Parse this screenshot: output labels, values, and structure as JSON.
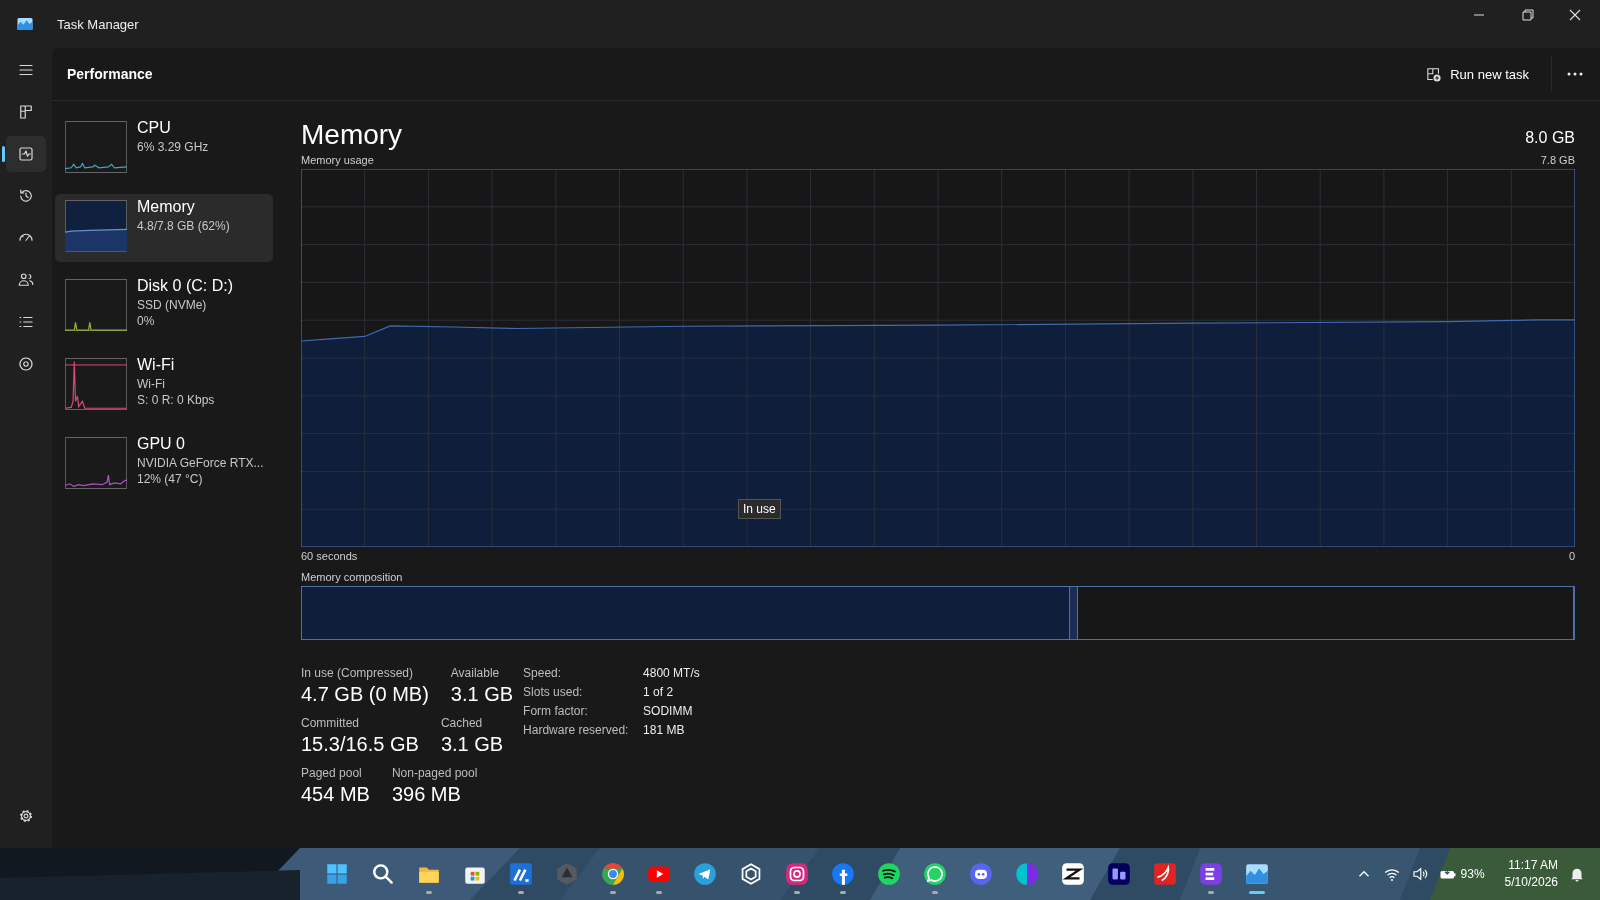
{
  "window": {
    "title": "Task Manager"
  },
  "nav": {
    "items": [
      {
        "kind": "menu",
        "selected": false
      },
      {
        "kind": "processes",
        "selected": false
      },
      {
        "kind": "performance",
        "selected": true
      },
      {
        "kind": "app_history",
        "selected": false
      },
      {
        "kind": "startup",
        "selected": false
      },
      {
        "kind": "users",
        "selected": false
      },
      {
        "kind": "details",
        "selected": false
      },
      {
        "kind": "services",
        "selected": false
      }
    ],
    "footer": {
      "kind": "settings",
      "selected": false
    }
  },
  "header": {
    "title": "Performance",
    "run_new_task": "Run new task"
  },
  "devices": [
    {
      "kind": "cpu",
      "name": "CPU",
      "lines": [
        "6% 3.29 GHz"
      ],
      "color": "#3aa8c8",
      "selected": false
    },
    {
      "kind": "memory",
      "name": "Memory",
      "lines": [
        "4.8/7.8 GB (62%)"
      ],
      "color": "#6b8fd0",
      "selected": true
    },
    {
      "kind": "disk",
      "name": "Disk 0 (C: D:)",
      "lines": [
        "SSD (NVMe)",
        "0%"
      ],
      "color": "#8fb339",
      "selected": false
    },
    {
      "kind": "wifi",
      "name": "Wi-Fi",
      "lines": [
        "Wi-Fi",
        "S: 0 R: 0 Kbps"
      ],
      "color": "#d6487e",
      "selected": false
    },
    {
      "kind": "gpu",
      "name": "GPU 0",
      "lines": [
        "NVIDIA GeForce RTX...",
        "12% (47 °C)"
      ],
      "color": "#b04fc9",
      "selected": false
    }
  ],
  "memory": {
    "title": "Memory",
    "total": "8.0 GB",
    "usage_label": "Memory usage",
    "usage_max": "7.8 GB",
    "x_start": "60 seconds",
    "x_end": "0",
    "tooltip": "In use",
    "composition_label": "Memory composition",
    "composition": [
      {
        "kind": "in_use",
        "level": 0.603
      },
      {
        "kind": "modified",
        "level": 0.006
      },
      {
        "kind": "standby",
        "level": 0.389
      }
    ],
    "stat_rows": [
      [
        {
          "label": "In use (Compressed)",
          "value": "4.7 GB (0 MB)"
        },
        {
          "label": "Available",
          "value": "3.1 GB"
        }
      ],
      [
        {
          "label": "Committed",
          "value": "15.3/16.5 GB"
        },
        {
          "label": "Cached",
          "value": "3.1 GB"
        }
      ],
      [
        {
          "label": "Paged pool",
          "value": "454 MB"
        },
        {
          "label": "Non-paged pool",
          "value": "396 MB"
        }
      ]
    ],
    "properties": [
      {
        "label": "Speed:",
        "value": "4800 MT/s"
      },
      {
        "label": "Slots used:",
        "value": "1 of 2"
      },
      {
        "label": "Form factor:",
        "value": "SODIMM"
      },
      {
        "label": "Hardware reserved:",
        "value": "181 MB"
      }
    ]
  },
  "taskbar": {
    "apps": [
      {
        "kind": "start",
        "running": false,
        "selected": false
      },
      {
        "kind": "search",
        "running": false,
        "selected": false
      },
      {
        "kind": "explorer",
        "running": true,
        "selected": false
      },
      {
        "kind": "store",
        "running": false,
        "selected": false
      },
      {
        "kind": "blue_app",
        "running": true,
        "selected": false
      },
      {
        "kind": "hexagon",
        "running": false,
        "selected": false
      },
      {
        "kind": "chrome",
        "running": true,
        "selected": false
      },
      {
        "kind": "youtube",
        "running": true,
        "selected": false
      },
      {
        "kind": "telegram",
        "running": false,
        "selected": false
      },
      {
        "kind": "knot",
        "running": false,
        "selected": false
      },
      {
        "kind": "instagram",
        "running": true,
        "selected": false
      },
      {
        "kind": "facebook",
        "running": true,
        "selected": false
      },
      {
        "kind": "spotify",
        "running": false,
        "selected": false
      },
      {
        "kind": "whatsapp",
        "running": true,
        "selected": false
      },
      {
        "kind": "discord",
        "running": false,
        "selected": false
      },
      {
        "kind": "canva",
        "running": false,
        "selected": false
      },
      {
        "kind": "capcut",
        "running": false,
        "selected": false
      },
      {
        "kind": "premiere",
        "running": false,
        "selected": false
      },
      {
        "kind": "pdf",
        "running": false,
        "selected": false
      },
      {
        "kind": "e_app",
        "running": true,
        "selected": false
      },
      {
        "kind": "task_manager",
        "running": true,
        "selected": true
      }
    ],
    "battery": "93%",
    "time": "11:17 AM",
    "date": "5/10/2026"
  }
}
